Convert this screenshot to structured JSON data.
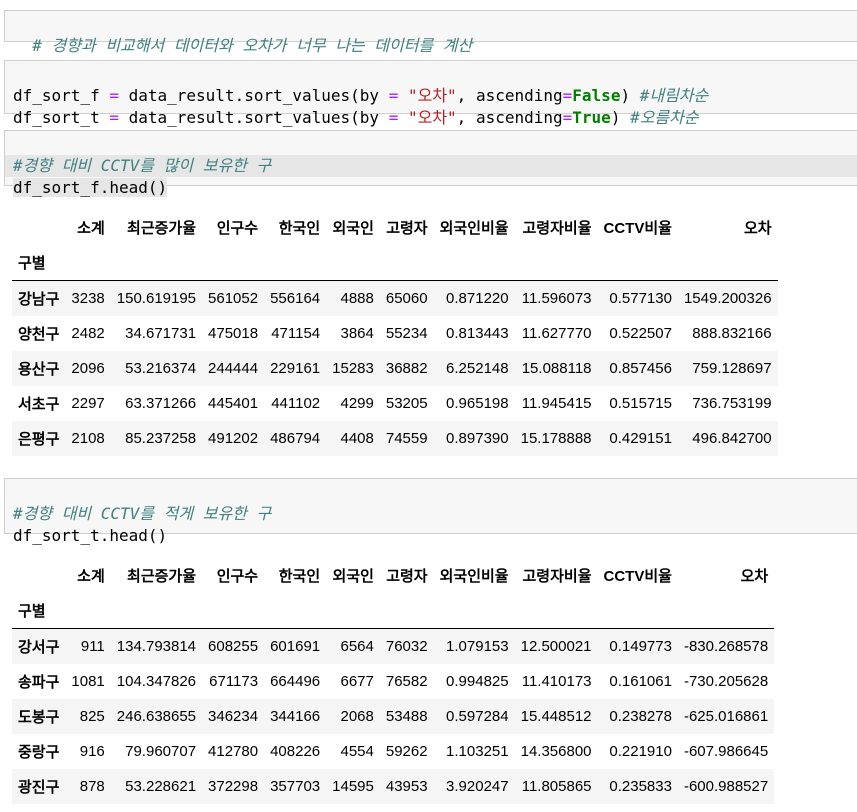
{
  "cells": {
    "comment1": "# 경향과 비교해서 데이터와 오차가 너무 나는 데이터를 계산",
    "code2": {
      "line1": {
        "a": "df_sort_f ",
        "eq": "=",
        "b": " data_result.sort_values(by ",
        "eq2": "=",
        "s": " \"오차\"",
        "c": ", ascending",
        "eq3": "=",
        "kw": "False",
        "d": ") ",
        "cm": "#내림차순"
      },
      "line2": {
        "a": "df_sort_t ",
        "eq": "=",
        "b": " data_result.sort_values(by ",
        "eq2": "=",
        "s": " \"오차\"",
        "c": ", ascending",
        "eq3": "=",
        "kw": "True",
        "d": ") ",
        "cm": "#오름차순"
      }
    },
    "code3": {
      "comment": "#경향 대비 CCTV를 많이 보유한 구",
      "code": "df_sort_f.head()"
    },
    "code4": {
      "comment": "#경향 대비 CCTV를 적게 보유한 구",
      "code": "df_sort_t.head()"
    }
  },
  "columns": [
    "소계",
    "최근증가율",
    "인구수",
    "한국인",
    "외국인",
    "고령자",
    "외국인비율",
    "고령자비율",
    "CCTV비율",
    "오차"
  ],
  "index_name": "구별",
  "table1": [
    {
      "name": "강남구",
      "v": [
        "3238",
        "150.619195",
        "561052",
        "556164",
        "4888",
        "65060",
        "0.871220",
        "11.596073",
        "0.577130",
        "1549.200326"
      ]
    },
    {
      "name": "양천구",
      "v": [
        "2482",
        "34.671731",
        "475018",
        "471154",
        "3864",
        "55234",
        "0.813443",
        "11.627770",
        "0.522507",
        "888.832166"
      ]
    },
    {
      "name": "용산구",
      "v": [
        "2096",
        "53.216374",
        "244444",
        "229161",
        "15283",
        "36882",
        "6.252148",
        "15.088118",
        "0.857456",
        "759.128697"
      ]
    },
    {
      "name": "서초구",
      "v": [
        "2297",
        "63.371266",
        "445401",
        "441102",
        "4299",
        "53205",
        "0.965198",
        "11.945415",
        "0.515715",
        "736.753199"
      ]
    },
    {
      "name": "은평구",
      "v": [
        "2108",
        "85.237258",
        "491202",
        "486794",
        "4408",
        "74559",
        "0.897390",
        "15.178888",
        "0.429151",
        "496.842700"
      ]
    }
  ],
  "table2": [
    {
      "name": "강서구",
      "v": [
        "911",
        "134.793814",
        "608255",
        "601691",
        "6564",
        "76032",
        "1.079153",
        "12.500021",
        "0.149773",
        "-830.268578"
      ]
    },
    {
      "name": "송파구",
      "v": [
        "1081",
        "104.347826",
        "671173",
        "664496",
        "6677",
        "76582",
        "0.994825",
        "11.410173",
        "0.161061",
        "-730.205628"
      ]
    },
    {
      "name": "도봉구",
      "v": [
        "825",
        "246.638655",
        "346234",
        "344166",
        "2068",
        "53488",
        "0.597284",
        "15.448512",
        "0.238278",
        "-625.016861"
      ]
    },
    {
      "name": "중랑구",
      "v": [
        "916",
        "79.960707",
        "412780",
        "408226",
        "4554",
        "59262",
        "1.103251",
        "14.356800",
        "0.221910",
        "-607.986645"
      ]
    },
    {
      "name": "광진구",
      "v": [
        "878",
        "53.228621",
        "372298",
        "357703",
        "14595",
        "43953",
        "3.920247",
        "11.805865",
        "0.235833",
        "-600.988527"
      ]
    }
  ]
}
